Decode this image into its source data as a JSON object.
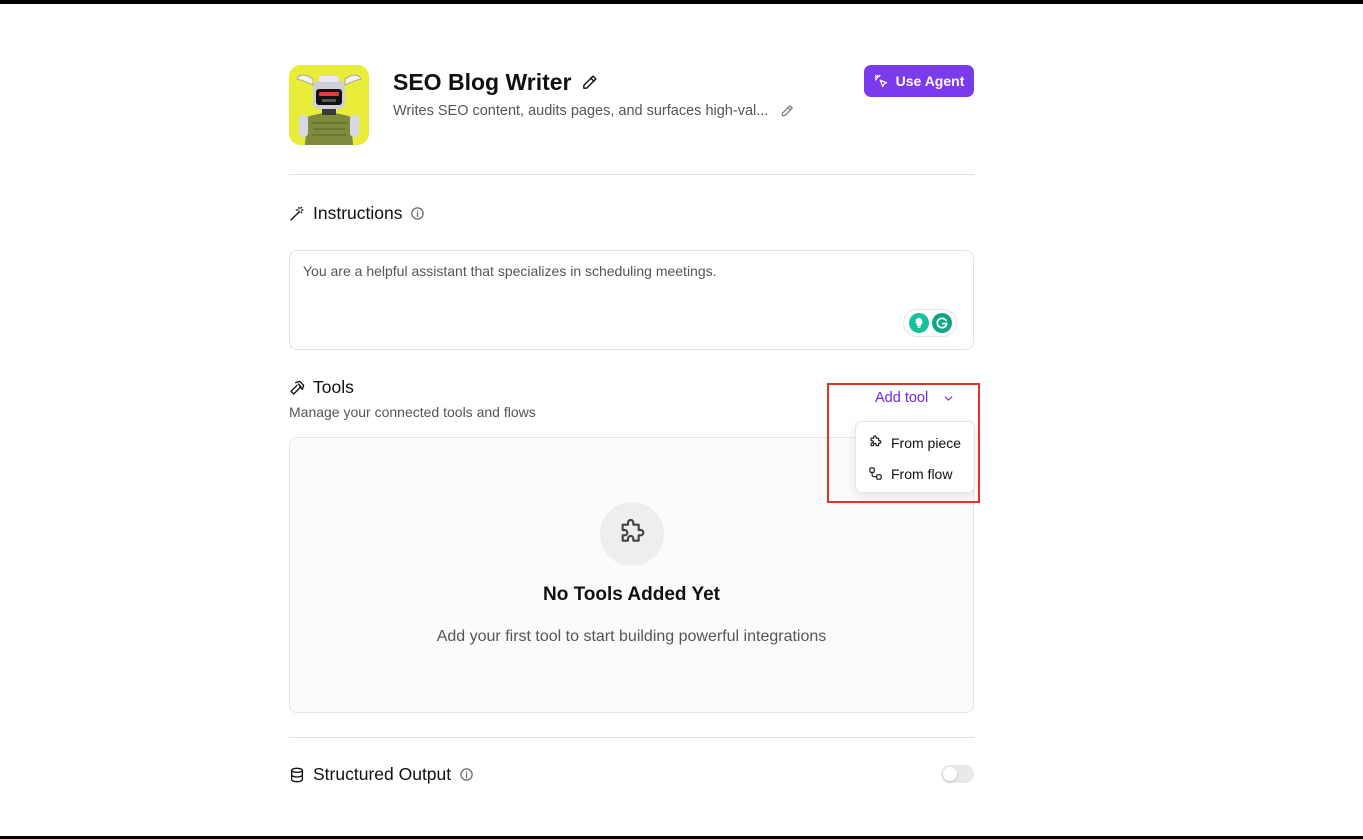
{
  "agent": {
    "name": "SEO Blog Writer",
    "description": "Writes SEO content, audits pages, and surfaces high-val...",
    "use_agent_label": "Use Agent"
  },
  "instructions": {
    "title": "Instructions",
    "value": "You are a helpful assistant that specializes in scheduling meetings."
  },
  "tools": {
    "title": "Tools",
    "subtitle": "Manage your connected tools and flows",
    "add_tool_label": "Add tool",
    "menu": [
      {
        "label": "From piece",
        "icon": "puzzle-icon"
      },
      {
        "label": "From flow",
        "icon": "flow-icon"
      }
    ],
    "empty_title": "No Tools Added Yet",
    "empty_desc": "Add your first tool to start building powerful integrations"
  },
  "structured_output": {
    "title": "Structured Output",
    "enabled": false
  },
  "colors": {
    "accent": "#7c3aed",
    "highlight": "#e53321",
    "avatar_bg": "#e9ec39"
  }
}
